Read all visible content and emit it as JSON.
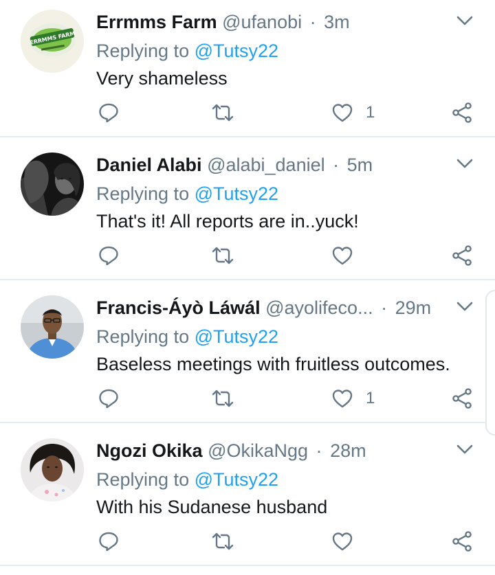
{
  "replying_label": "Replying to",
  "tweets": [
    {
      "name": "Errmms Farm",
      "handle": "@ufanobi",
      "dot": "·",
      "time": "3m",
      "reply_to": "@Tutsy22",
      "text": "Very shameless",
      "likes": "1",
      "avatar_icon": "farm-logo-avatar",
      "avatar_text": "ERRMMS FARM"
    },
    {
      "name": "Daniel Alabi",
      "handle": "@alabi_daniel",
      "dot": "·",
      "time": "5m",
      "reply_to": "@Tutsy22",
      "text": "That's it! All reports are in..yuck!",
      "likes": "",
      "avatar_icon": "person-photo-avatar"
    },
    {
      "name": "Francis-Áyò Láwál",
      "handle": "@ayolifeco...",
      "dot": "·",
      "time": "29m",
      "reply_to": "@Tutsy22",
      "text": "Baseless meetings with fruitless outcomes.",
      "likes": "1",
      "avatar_icon": "person-photo-avatar"
    },
    {
      "name": "Ngozi Okika",
      "handle": "@OkikaNgg",
      "dot": "·",
      "time": "28m",
      "reply_to": "@Tutsy22",
      "text": "With his Sudanese husband",
      "likes": "",
      "avatar_icon": "person-photo-avatar"
    }
  ],
  "icons": {
    "reply": "reply-icon",
    "retweet": "retweet-icon",
    "like": "heart-icon",
    "share": "share-icon",
    "menu": "chevron-down-icon"
  },
  "colors": {
    "link": "#1da1f2",
    "secondary_text": "#657786",
    "icon": "#657786",
    "divider": "#e6ecf0"
  }
}
